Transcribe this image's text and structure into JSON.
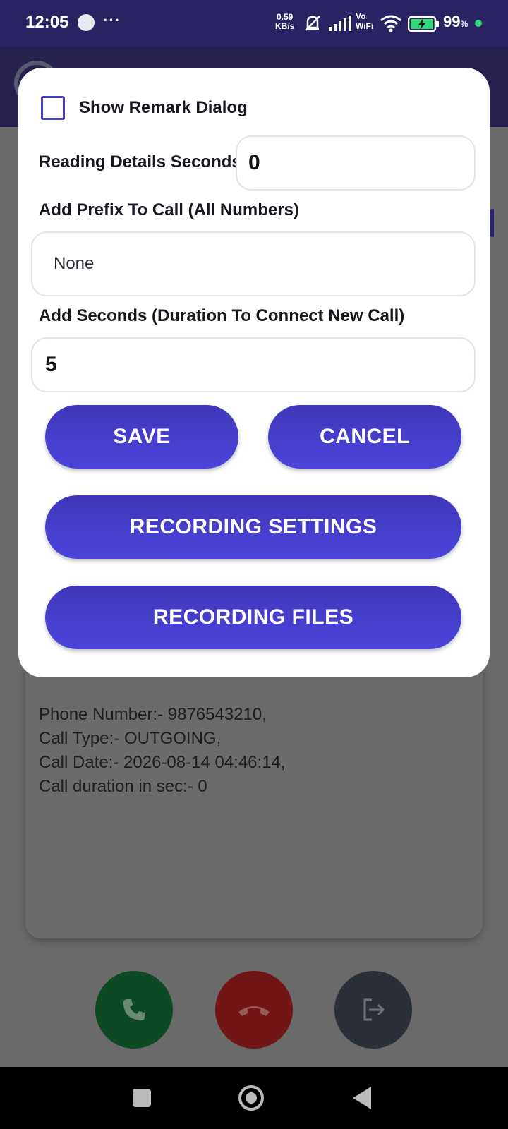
{
  "status_bar": {
    "time": "12:05",
    "more": "···",
    "net_speed_value": "0.59",
    "net_speed_unit": "KB/s",
    "vowifi_top": "Vo",
    "vowifi_bottom": "WiFi",
    "battery_percent": "99",
    "battery_symbol": "%"
  },
  "dialog": {
    "show_remark_label": "Show Remark Dialog",
    "show_remark_checked": false,
    "reading_details_label": "Reading Details Seconds",
    "reading_details_value": "0",
    "prefix_label": "Add Prefix To Call (All Numbers)",
    "prefix_value": "None",
    "add_seconds_label": "Add Seconds (Duration To Connect New Call)",
    "add_seconds_value": "5",
    "save_label": "SAVE",
    "cancel_label": "CANCEL",
    "recording_settings_label": "RECORDING SETTINGS",
    "recording_files_label": "RECORDING FILES"
  },
  "call_info": {
    "phone": "Phone Number:- 9876543210,",
    "type": "Call Type:- OUTGOING,",
    "date": "Call Date:- 2026-08-14 04:46:14,",
    "duration": "Call duration in sec:- 0"
  },
  "actions": {
    "call_icon": "phone-icon",
    "end_icon": "end-call-icon",
    "exit_icon": "exit-icon"
  },
  "colors": {
    "accent": "#4a44c9",
    "status_bar": "#2a2363",
    "call": "#0d4a23",
    "end": "#711515",
    "exit": "#2b2f38"
  }
}
